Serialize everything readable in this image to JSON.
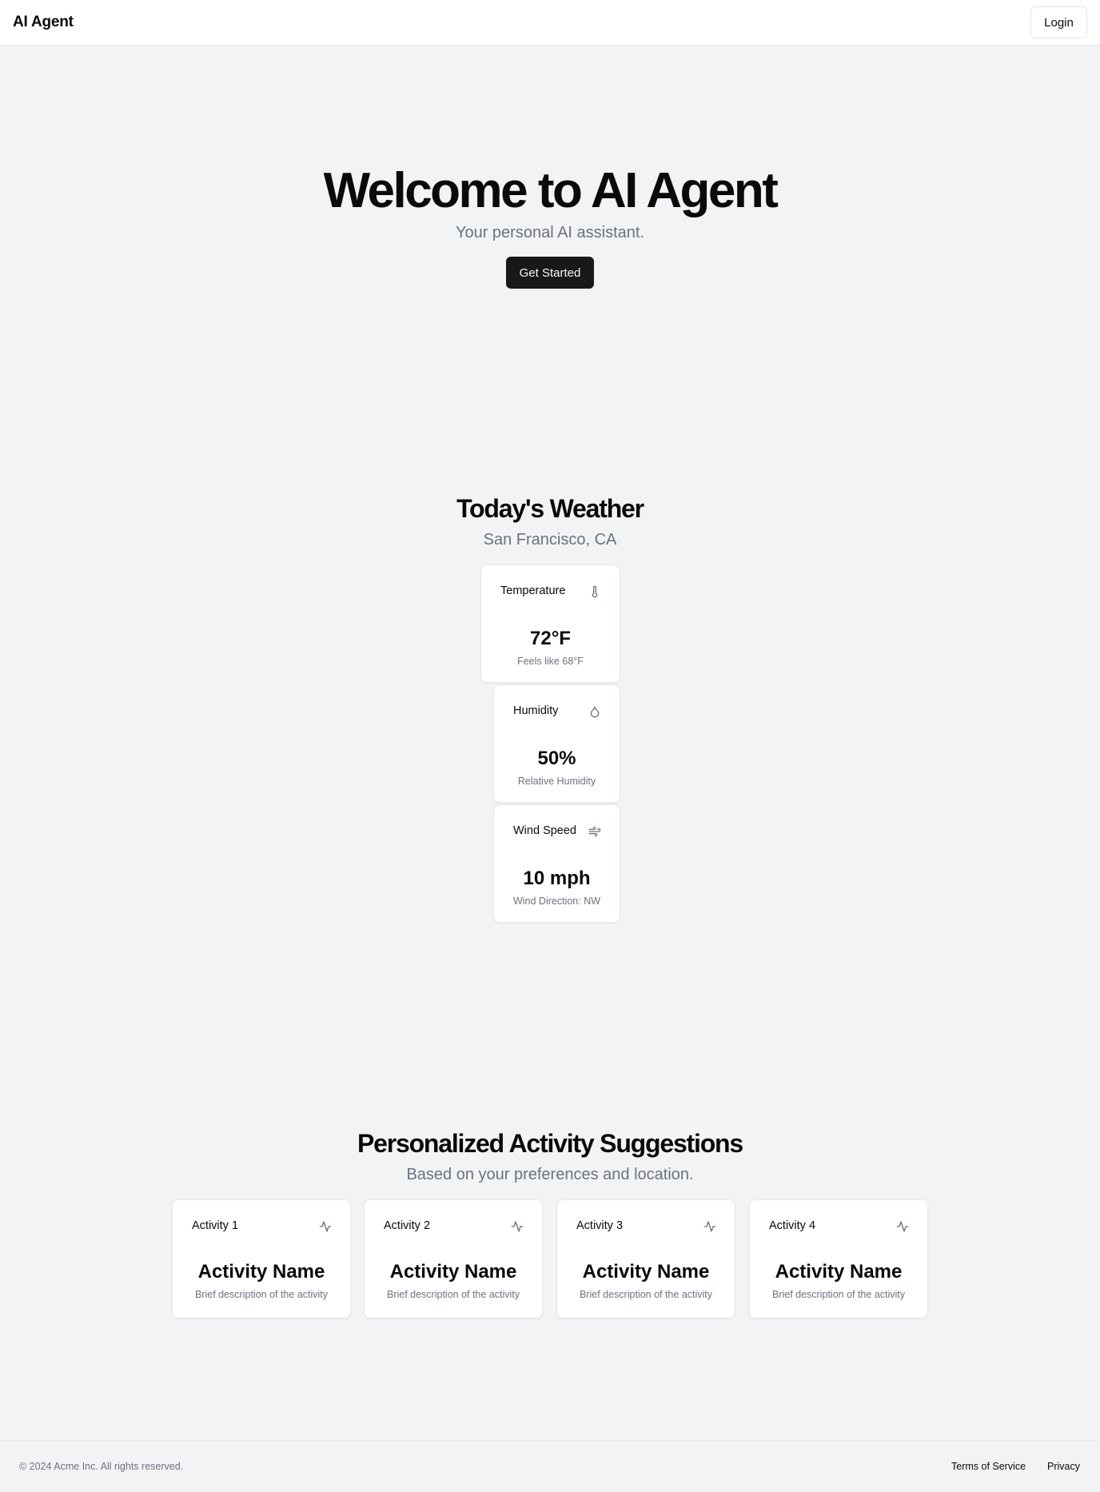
{
  "header": {
    "brand": "AI Agent",
    "login_label": "Login"
  },
  "hero": {
    "title": "Welcome to AI Agent",
    "subtitle": "Your personal AI assistant.",
    "cta_label": "Get Started"
  },
  "weather": {
    "title": "Today's Weather",
    "location": "San Francisco, CA",
    "cards": [
      {
        "label": "Temperature",
        "value": "72°F",
        "note": "Feels like 68°F",
        "icon": "thermometer-icon"
      },
      {
        "label": "Humidity",
        "value": "50%",
        "note": "Relative Humidity",
        "icon": "droplet-icon"
      },
      {
        "label": "Wind Speed",
        "value": "10 mph",
        "note": "Wind Direction: NW",
        "icon": "wind-icon"
      }
    ]
  },
  "activities": {
    "title": "Personalized Activity Suggestions",
    "subtitle": "Based on your preferences and location.",
    "cards": [
      {
        "label": "Activity 1",
        "name": "Activity Name",
        "description": "Brief description of the activity",
        "icon": "activity-pulse-icon"
      },
      {
        "label": "Activity 2",
        "name": "Activity Name",
        "description": "Brief description of the activity",
        "icon": "activity-pulse-icon"
      },
      {
        "label": "Activity 3",
        "name": "Activity Name",
        "description": "Brief description of the activity",
        "icon": "activity-pulse-icon"
      },
      {
        "label": "Activity 4",
        "name": "Activity Name",
        "description": "Brief description of the activity",
        "icon": "activity-pulse-icon"
      }
    ]
  },
  "footer": {
    "copyright": "© 2024 Acme Inc. All rights reserved.",
    "links": [
      "Terms of Service",
      "Privacy"
    ]
  },
  "colors": {
    "background": "#f2f3f5",
    "card": "#ffffff",
    "primary_button": "#18181b",
    "muted_text": "#6b7280",
    "border": "#e5e7eb"
  }
}
